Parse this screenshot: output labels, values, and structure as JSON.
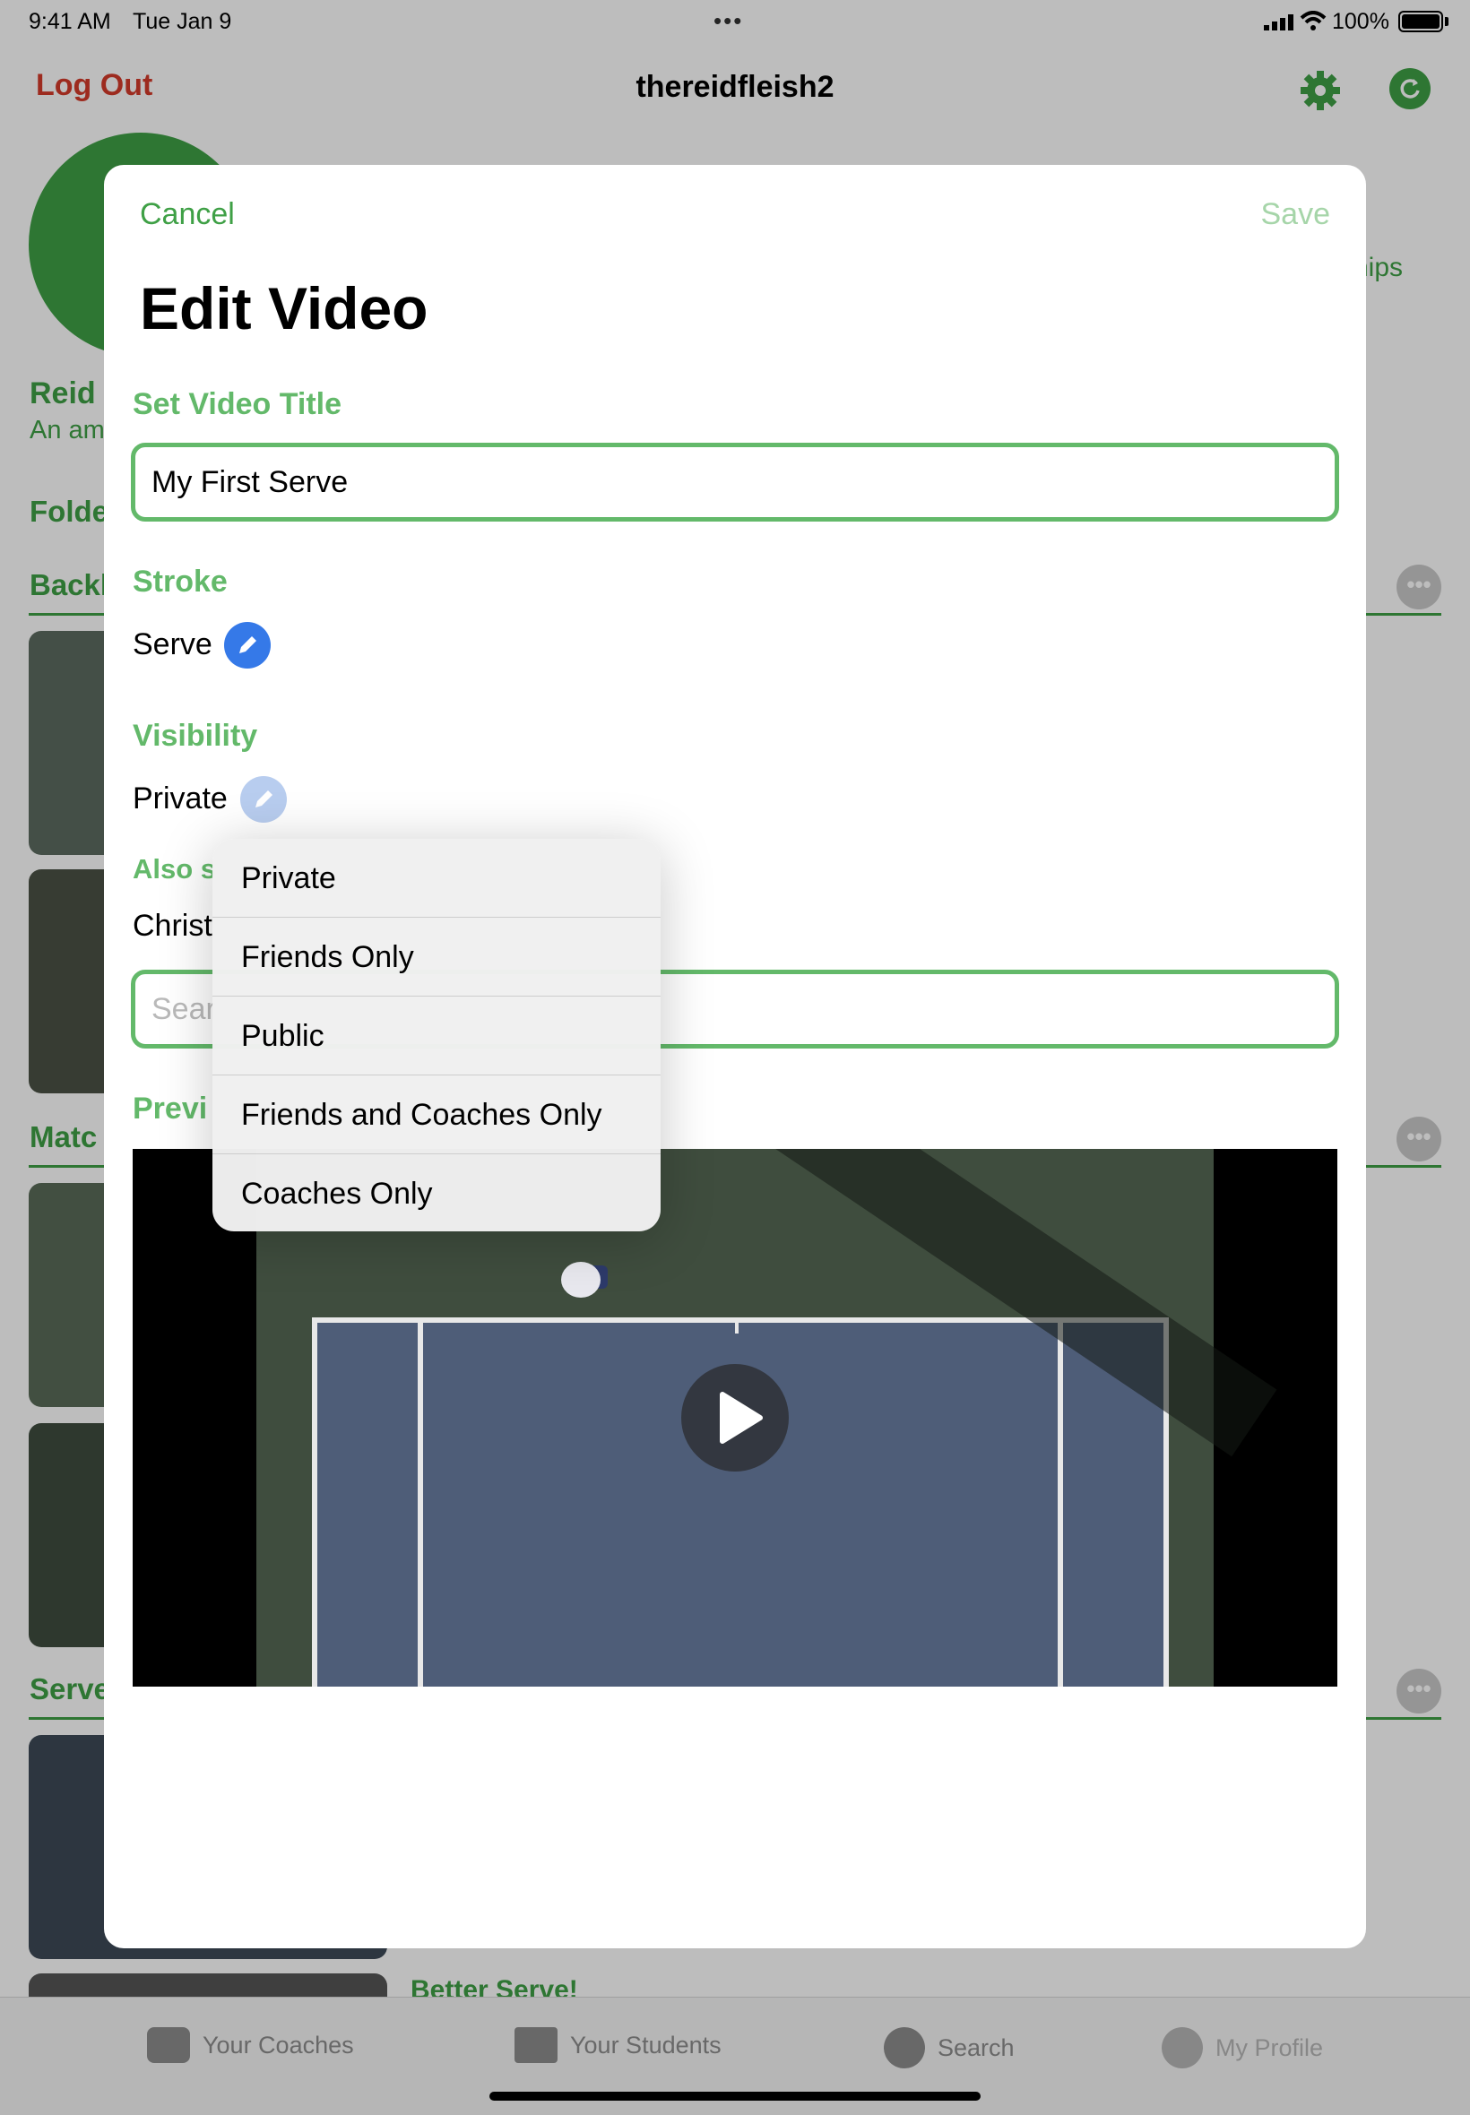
{
  "status_bar": {
    "time": "9:41 AM",
    "date": "Tue Jan 9",
    "battery": "100%"
  },
  "nav": {
    "logout_label": "Log Out",
    "title": "thereidfleish2"
  },
  "background": {
    "name_partial": "Reid",
    "subtitle_partial": "An am",
    "folders_partial": "Folde",
    "ships_partial": "hips",
    "section_1_partial": "Backh",
    "section_2_partial": "Matc",
    "section_3_partial": "Serve",
    "better_serve": "Better Serve!",
    "more_symbol": "•••"
  },
  "tabbar": {
    "tabs": [
      {
        "label": "Your Coaches"
      },
      {
        "label": "Your Students"
      },
      {
        "label": "Search"
      },
      {
        "label": "My Profile"
      }
    ]
  },
  "sheet": {
    "cancel_label": "Cancel",
    "save_label": "Save",
    "title": "Edit Video",
    "title_section_label": "Set Video Title",
    "title_value": "My First Serve",
    "stroke_label": "Stroke",
    "stroke_value": "Serve",
    "visibility_label": "Visibility",
    "visibility_value": "Private",
    "also_share_partial": "Also s",
    "shared_with_partial": "Christ",
    "search_placeholder_partial": "Sear",
    "preview_partial": "Previ"
  },
  "visibility_menu": {
    "options": [
      "Private",
      "Friends Only",
      "Public",
      "Friends and Coaches Only",
      "Coaches Only"
    ]
  },
  "colors": {
    "accent_green": "#3fa046",
    "label_green": "#63b96a",
    "logout_red": "#d43a2a",
    "edit_blue": "#3579e8"
  }
}
